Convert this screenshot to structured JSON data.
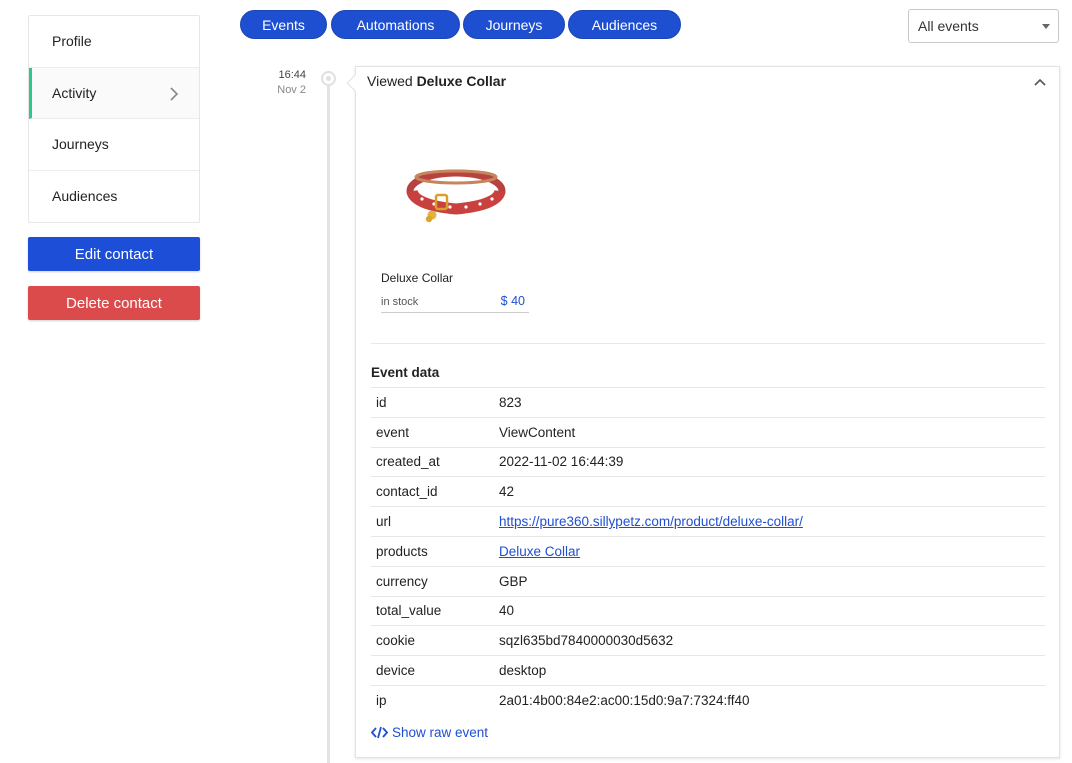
{
  "sidebar": {
    "items": [
      {
        "label": "Profile"
      },
      {
        "label": "Activity"
      },
      {
        "label": "Journeys"
      },
      {
        "label": "Audiences"
      }
    ],
    "edit_label": "Edit contact",
    "delete_label": "Delete contact"
  },
  "tabs": [
    {
      "label": "Events"
    },
    {
      "label": "Automations"
    },
    {
      "label": "Journeys"
    },
    {
      "label": "Audiences"
    }
  ],
  "filter": {
    "selected": "All events"
  },
  "timeline": {
    "time": "16:44",
    "date": "Nov 2"
  },
  "event": {
    "title_prefix": "Viewed",
    "title_item": "Deluxe Collar",
    "product": {
      "name": "Deluxe Collar",
      "stock": "in stock",
      "price": "$ 40"
    },
    "data_title": "Event data",
    "rows": [
      {
        "key": "id",
        "value": "823"
      },
      {
        "key": "event",
        "value": "ViewContent"
      },
      {
        "key": "created_at",
        "value": "2022-11-02 16:44:39"
      },
      {
        "key": "contact_id",
        "value": "42"
      },
      {
        "key": "url",
        "value": "https://pure360.sillypetz.com/product/deluxe-collar/"
      },
      {
        "key": "products",
        "value": "Deluxe Collar"
      },
      {
        "key": "currency",
        "value": "GBP"
      },
      {
        "key": "total_value",
        "value": "40"
      },
      {
        "key": "cookie",
        "value": "sqzl635bd7840000030d5632"
      },
      {
        "key": "device",
        "value": "desktop"
      },
      {
        "key": "ip",
        "value": "2a01:4b00:84e2:ac00:15d0:9a7:7324:ff40"
      }
    ],
    "raw_label": "Show raw event"
  },
  "colors": {
    "primary": "#1f4fd1",
    "danger": "#dc4b4b",
    "active_accent": "#2ec98a"
  }
}
